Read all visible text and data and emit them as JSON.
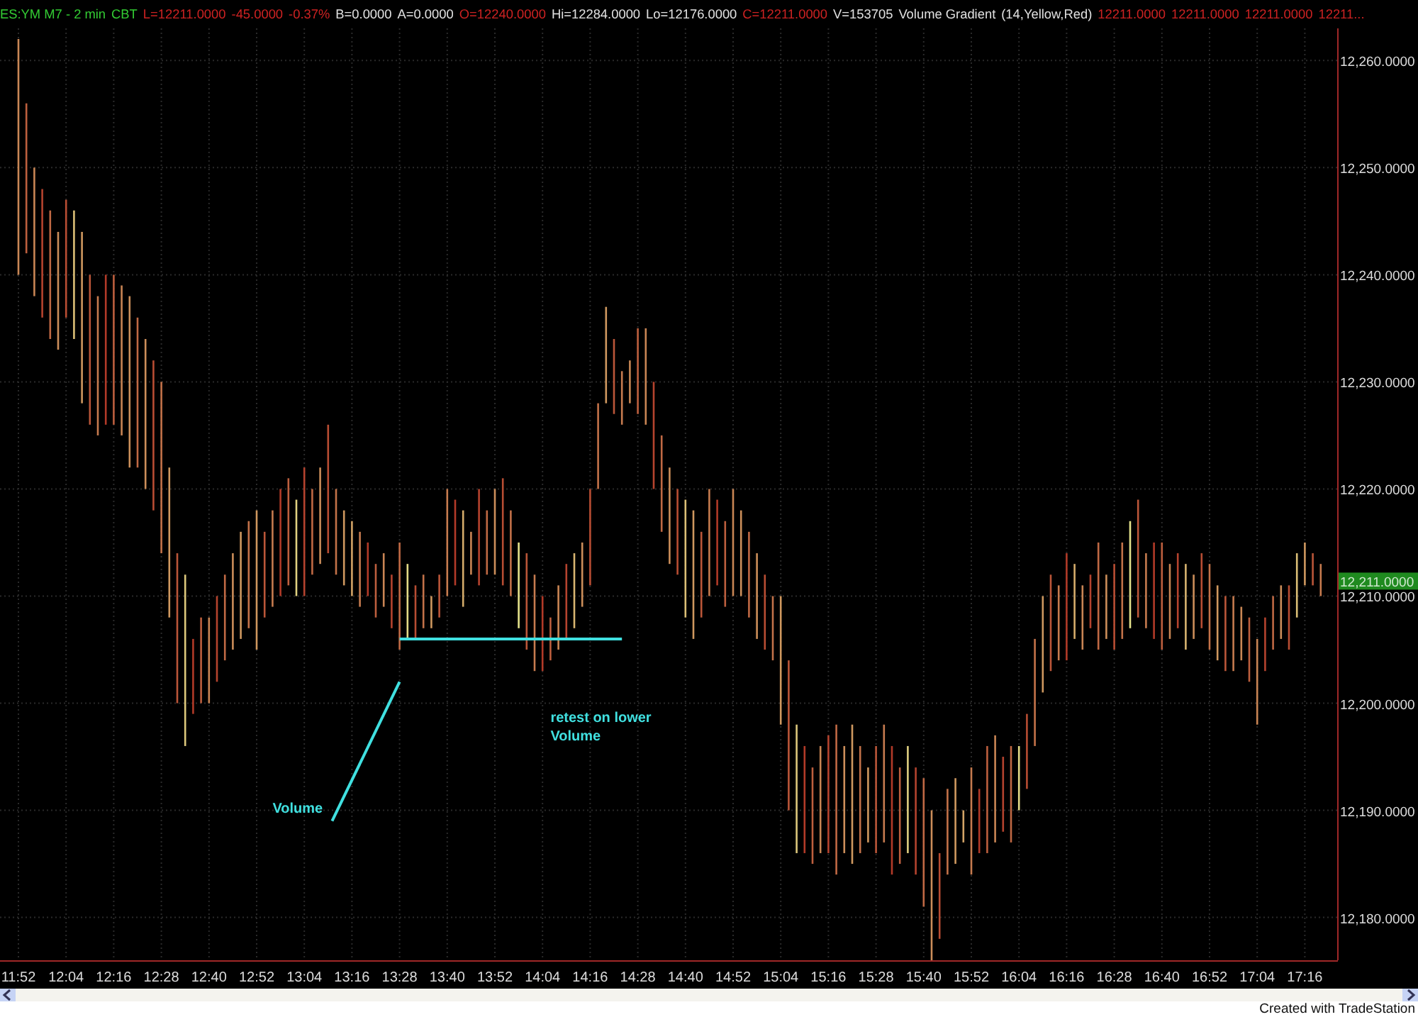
{
  "header": [
    {
      "text": "ES:YM M7 - 2 min",
      "color": "#33cc33"
    },
    {
      "text": "CBT",
      "color": "#33cc33"
    },
    {
      "text": "L=12211.0000",
      "color": "#cc2222"
    },
    {
      "text": "-45.0000",
      "color": "#cc2222"
    },
    {
      "text": "-0.37%",
      "color": "#cc2222"
    },
    {
      "text": "B=0.0000",
      "color": "#e0e0e0"
    },
    {
      "text": "A=0.0000",
      "color": "#e0e0e0"
    },
    {
      "text": "O=12240.0000",
      "color": "#cc2222"
    },
    {
      "text": "Hi=12284.0000",
      "color": "#e0e0e0"
    },
    {
      "text": "Lo=12176.0000",
      "color": "#e0e0e0"
    },
    {
      "text": "C=12211.0000",
      "color": "#cc2222"
    },
    {
      "text": "V=153705",
      "color": "#e0e0e0"
    },
    {
      "text": "Volume Gradient",
      "color": "#e0e0e0"
    },
    {
      "text": "(14,Yellow,Red)",
      "color": "#e0e0e0"
    },
    {
      "text": "12211.0000",
      "color": "#cc2222"
    },
    {
      "text": "12211.0000",
      "color": "#cc2222"
    },
    {
      "text": "12211.0000",
      "color": "#cc2222"
    },
    {
      "text": "12211...",
      "color": "#cc2222"
    }
  ],
  "chart": {
    "y_axis": [
      "12,260.0000",
      "12,250.0000",
      "12,240.0000",
      "12,230.0000",
      "12,220.0000",
      "12,210.0000",
      "12,200.0000",
      "12,190.0000",
      "12,180.0000"
    ],
    "x_axis": [
      "11:52",
      "12:04",
      "12:16",
      "12:28",
      "12:40",
      "12:52",
      "13:04",
      "13:16",
      "13:28",
      "13:40",
      "13:52",
      "14:04",
      "14:16",
      "14:28",
      "14:40",
      "14:52",
      "15:04",
      "15:16",
      "15:28",
      "15:40",
      "15:52",
      "16:04",
      "16:16",
      "16:28",
      "16:40",
      "16:52",
      "17:04",
      "17:16"
    ],
    "last_price": "12,211.0000",
    "annotations": [
      "Volume",
      "retest on lower Volume"
    ]
  },
  "footer": {
    "text": "Created with TradeStation"
  }
}
